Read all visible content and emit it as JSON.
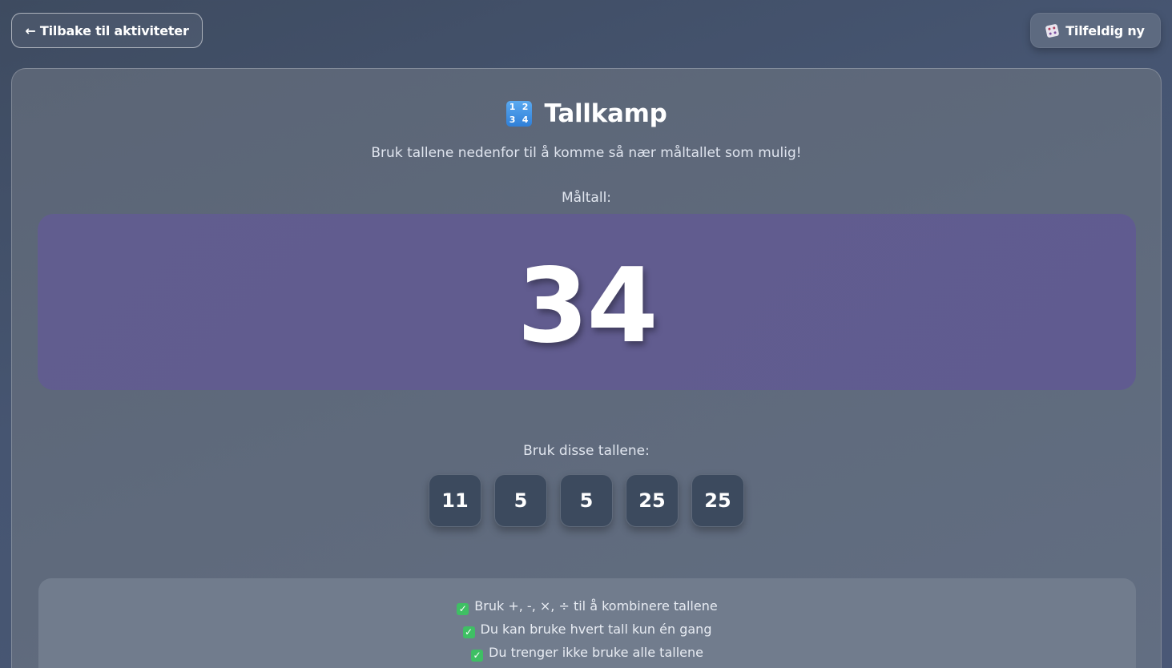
{
  "header": {
    "back_label": "← Tilbake til aktiviteter",
    "random_label": "Tilfeldig ny",
    "random_icon": "dice-icon"
  },
  "game": {
    "icon": "numbers-icon",
    "icon_digits": [
      "1",
      "2",
      "3",
      "4"
    ],
    "title": "Tallkamp",
    "subtitle": "Bruk tallene nedenfor til å komme så nær måltallet som mulig!",
    "target_label": "Måltall:",
    "target_value": "34",
    "numbers_label": "Bruk disse tallene:",
    "numbers": [
      "11",
      "5",
      "5",
      "25",
      "25"
    ]
  },
  "rules": {
    "check_icon": "check-icon",
    "items": [
      "Bruk +, -, ×, ÷ til å kombinere tallene",
      "Du kan bruke hvert tall kun én gang",
      "Du trenger ikke bruke alle tallene"
    ]
  },
  "colors": {
    "target_box": "#615d8f",
    "tile": "#3c4a5e",
    "check": "#3fbf64"
  }
}
